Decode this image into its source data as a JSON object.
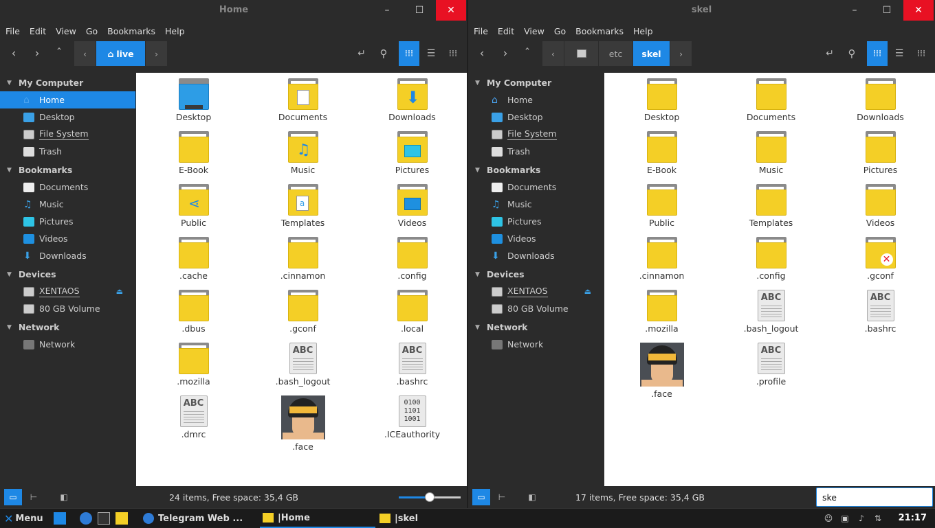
{
  "left_window": {
    "title": "Home",
    "menu": [
      "File",
      "Edit",
      "View",
      "Go",
      "Bookmarks",
      "Help"
    ],
    "path_crumbs": [
      {
        "label": "live",
        "active": true
      }
    ],
    "sidebar": {
      "my_computer": "My Computer",
      "computer_items": [
        "Home",
        "Desktop",
        "File System",
        "Trash"
      ],
      "bookmarks": "Bookmarks",
      "bookmark_items": [
        "Documents",
        "Music",
        "Pictures",
        "Videos",
        "Downloads"
      ],
      "devices": "Devices",
      "device_items": [
        "XENTAOS",
        "80 GB Volume"
      ],
      "network": "Network",
      "network_items": [
        "Network"
      ]
    },
    "files": [
      {
        "name": "Desktop",
        "icon": "folder-desktop"
      },
      {
        "name": "Documents",
        "icon": "folder-documents"
      },
      {
        "name": "Downloads",
        "icon": "folder-downloads"
      },
      {
        "name": "E-Book",
        "icon": "folder"
      },
      {
        "name": "Music",
        "icon": "folder-music"
      },
      {
        "name": "Pictures",
        "icon": "folder-pictures"
      },
      {
        "name": "Public",
        "icon": "folder-public"
      },
      {
        "name": "Templates",
        "icon": "folder-templates"
      },
      {
        "name": "Videos",
        "icon": "folder-videos"
      },
      {
        "name": ".cache",
        "icon": "folder"
      },
      {
        "name": ".cinnamon",
        "icon": "folder"
      },
      {
        "name": ".config",
        "icon": "folder"
      },
      {
        "name": ".dbus",
        "icon": "folder"
      },
      {
        "name": ".gconf",
        "icon": "folder"
      },
      {
        "name": ".local",
        "icon": "folder"
      },
      {
        "name": ".mozilla",
        "icon": "folder"
      },
      {
        "name": ".bash_logout",
        "icon": "text-file"
      },
      {
        "name": ".bashrc",
        "icon": "text-file"
      },
      {
        "name": ".dmrc",
        "icon": "text-file"
      },
      {
        "name": ".face",
        "icon": "face-image"
      },
      {
        "name": ".ICEauthority",
        "icon": "binary-file"
      }
    ],
    "status": "24 items, Free space: 35,4 GB",
    "zoom_level": 0.5
  },
  "right_window": {
    "title": "skel",
    "menu": [
      "File",
      "Edit",
      "View",
      "Go",
      "Bookmarks",
      "Help"
    ],
    "path_crumbs": [
      {
        "label": "",
        "active": false
      },
      {
        "label": "etc",
        "active": false
      },
      {
        "label": "skel",
        "active": true
      }
    ],
    "sidebar": {
      "my_computer": "My Computer",
      "computer_items": [
        "Home",
        "Desktop",
        "File System",
        "Trash"
      ],
      "bookmarks": "Bookmarks",
      "bookmark_items": [
        "Documents",
        "Music",
        "Pictures",
        "Videos",
        "Downloads"
      ],
      "devices": "Devices",
      "device_items": [
        "XENTAOS",
        "80 GB Volume"
      ],
      "network": "Network",
      "network_items": [
        "Network"
      ]
    },
    "files": [
      {
        "name": "Desktop",
        "icon": "folder"
      },
      {
        "name": "Documents",
        "icon": "folder"
      },
      {
        "name": "Downloads",
        "icon": "folder"
      },
      {
        "name": "E-Book",
        "icon": "folder"
      },
      {
        "name": "Music",
        "icon": "folder"
      },
      {
        "name": "Pictures",
        "icon": "folder"
      },
      {
        "name": "Public",
        "icon": "folder"
      },
      {
        "name": "Templates",
        "icon": "folder"
      },
      {
        "name": "Videos",
        "icon": "folder"
      },
      {
        "name": ".cinnamon",
        "icon": "folder"
      },
      {
        "name": ".config",
        "icon": "folder"
      },
      {
        "name": ".gconf",
        "icon": "folder-error"
      },
      {
        "name": ".mozilla",
        "icon": "folder"
      },
      {
        "name": ".bash_logout",
        "icon": "text-file"
      },
      {
        "name": ".bashrc",
        "icon": "text-file"
      },
      {
        "name": ".face",
        "icon": "face-image"
      },
      {
        "name": ".profile",
        "icon": "text-file"
      }
    ],
    "status": "17 items, Free space: 35,4 GB",
    "search_value": "ske"
  },
  "taskbar": {
    "menu_label": "Menu",
    "tasks": [
      {
        "label": "Telegram Web ...",
        "active": false
      },
      {
        "label": "|Home",
        "active": true
      },
      {
        "label": "|skel",
        "active": false
      }
    ],
    "clock": "21:17"
  },
  "colors": {
    "accent": "#1e88e5",
    "folder": "#f4cf26",
    "close_red": "#e81123"
  }
}
